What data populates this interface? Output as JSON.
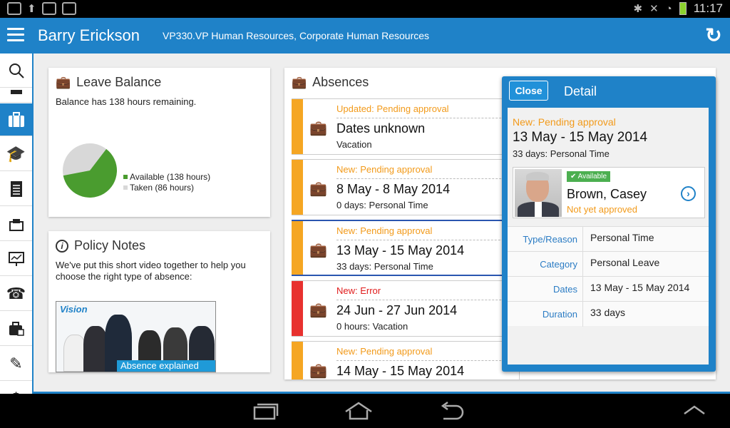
{
  "status_bar": {
    "time": "11:17"
  },
  "app_bar": {
    "user_name": "Barry Erickson",
    "org": "VP330.VP Human Resources, Corporate Human Resources"
  },
  "nav_items": [
    {
      "name": "search",
      "icon": "search-icon"
    },
    {
      "name": "briefcase",
      "icon": "briefcase-icon"
    },
    {
      "name": "training",
      "icon": "graduation-cap-icon"
    },
    {
      "name": "documents",
      "icon": "document-icon"
    },
    {
      "name": "tasks",
      "icon": "inbox-icon"
    },
    {
      "name": "presentation",
      "icon": "presentation-icon"
    },
    {
      "name": "phone",
      "icon": "phone-icon"
    },
    {
      "name": "absence",
      "icon": "absence-icon"
    },
    {
      "name": "edit",
      "icon": "edit-icon"
    },
    {
      "name": "pay",
      "icon": "dollar-icon"
    }
  ],
  "leave_balance": {
    "title": "Leave Balance",
    "text": "Balance has 138 hours remaining.",
    "available_label": "Available (138 hours)",
    "taken_label": "Taken (86 hours)",
    "available_hours": 138,
    "taken_hours": 86,
    "colors": {
      "available": "#4a9c2f",
      "taken": "#d8d8d8"
    }
  },
  "policy_notes": {
    "title": "Policy Notes",
    "text": "We've put this short video together to help you choose the right type of absence:",
    "video_logo": "Vision",
    "video_caption": "Absence explained"
  },
  "absences": {
    "title": "Absences",
    "items": [
      {
        "status": "Updated: Pending approval",
        "status_color": "#f29a1a",
        "bar_color": "#f5a623",
        "dates": "Dates unknown",
        "sub": "Vacation",
        "selected": false
      },
      {
        "status": "New: Pending approval",
        "status_color": "#f29a1a",
        "bar_color": "#f5a623",
        "dates": "8 May - 8 May 2014",
        "sub": "0 days: Personal Time",
        "selected": false
      },
      {
        "status": "New: Pending approval",
        "status_color": "#f29a1a",
        "bar_color": "#f5a623",
        "dates": "13 May - 15 May 2014",
        "sub": "33 days: Personal Time",
        "selected": true
      },
      {
        "status": "New: Error",
        "status_color": "#e01b1b",
        "bar_color": "#e8312f",
        "dates": "24 Jun - 27 Jun 2014",
        "sub": "0 hours: Vacation",
        "selected": false
      },
      {
        "status": "New: Pending approval",
        "status_color": "#f29a1a",
        "bar_color": "#f5a623",
        "dates": "14 May - 15 May 2014",
        "sub": "",
        "selected": false
      }
    ]
  },
  "detail": {
    "close_label": "Close",
    "title": "Detail",
    "status": "New: Pending approval",
    "dates": "13 May - 15 May 2014",
    "sub": "33 days: Personal Time",
    "approver": {
      "badge": "Available",
      "name": "Brown, Casey",
      "state": "Not yet approved"
    },
    "fields": [
      {
        "label": "Type/Reason",
        "value": "Personal Time"
      },
      {
        "label": "Category",
        "value": "Personal Leave"
      },
      {
        "label": "Dates",
        "value": "13 May - 15 May 2014"
      },
      {
        "label": "Duration",
        "value": "33 days"
      }
    ]
  },
  "colors": {
    "accent": "#1f82c8",
    "pending": "#f29a1a",
    "error": "#e01b1b"
  }
}
